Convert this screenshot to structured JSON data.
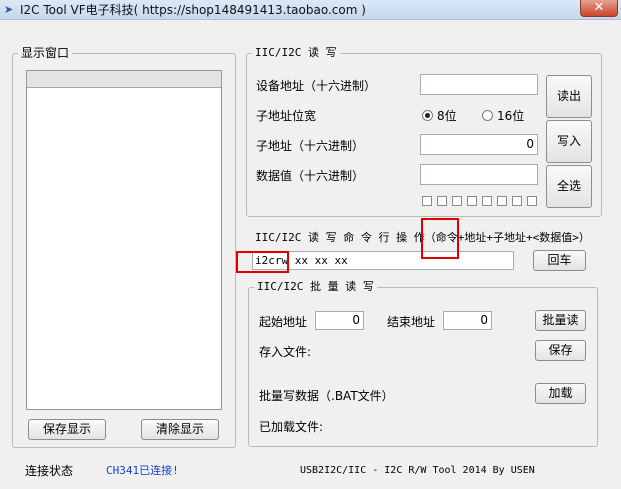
{
  "window": {
    "title": "I2C Tool   VF电子科技( https://shop148491413.taobao.com )",
    "close": "✕",
    "app_icon": "arrow-icon"
  },
  "display_panel": {
    "legend": "显示窗口",
    "save_button": "保存显示",
    "clear_button": "清除显示"
  },
  "rw_panel": {
    "legend": "IIC/I2C 读 写",
    "device_addr_label": "设备地址（十六进制）",
    "device_addr_value": "",
    "subaddr_width_label": "子地址位宽",
    "opt_8bit": "8位",
    "opt_16bit": "16位",
    "subaddr_label": "子地址（十六进制）",
    "subaddr_value": "0",
    "data_label": "数据值（十六进制）",
    "data_value": "",
    "read_button": "读出",
    "write_button": "写入",
    "select_all_button": "全选"
  },
  "command": {
    "label": "IIC/I2C 读 写 命 令 行 操 作（命令+地址+子地址+<数据值>）",
    "input_value": "i2crw xx xx xx",
    "enter_button": "回车"
  },
  "batch_panel": {
    "legend": "IIC/I2C 批 量 读 写",
    "start_addr_label": "起始地址",
    "start_addr_value": "0",
    "end_addr_label": "结束地址",
    "end_addr_value": "0",
    "batch_read_button": "批量读",
    "save_file_label": "存入文件:",
    "save_button": "保存",
    "batch_write_label": "批量写数据（.BAT文件）",
    "load_button": "加载",
    "loaded_file_label": "已加载文件:"
  },
  "status": {
    "label": "连接状态",
    "value": "CH341已连接!",
    "footer": "USB2I2C/IIC - I2C R/W Tool 2014 By USEN"
  }
}
